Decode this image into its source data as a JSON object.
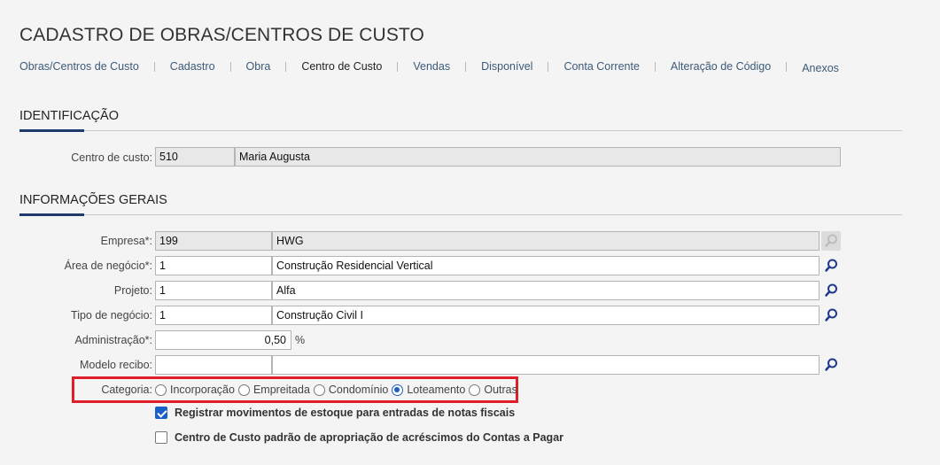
{
  "page": {
    "title": "CADASTRO DE OBRAS/CENTROS DE CUSTO"
  },
  "tabs": [
    {
      "label": "Obras/Centros de Custo"
    },
    {
      "label": "Cadastro"
    },
    {
      "label": "Obra"
    },
    {
      "label": "Centro de Custo"
    },
    {
      "label": "Vendas"
    },
    {
      "label": "Disponível"
    },
    {
      "label": "Conta Corrente"
    },
    {
      "label": "Alteração de Código"
    },
    {
      "label": "Anexos"
    }
  ],
  "identificacao": {
    "title": "IDENTIFICAÇÃO",
    "centro_label": "Centro de custo:",
    "centro_code": "510",
    "centro_name": "Maria Augusta"
  },
  "info": {
    "title": "INFORMAÇÕES GERAIS",
    "empresa": {
      "label": "Empresa*:",
      "code": "199",
      "name": "HWG"
    },
    "area": {
      "label": "Área de negócio*:",
      "code": "1",
      "name": "Construção Residencial Vertical"
    },
    "projeto": {
      "label": "Projeto:",
      "code": "1",
      "name": "Alfa"
    },
    "tipo": {
      "label": "Tipo de negócio:",
      "code": "1",
      "name": "Construção Civil I"
    },
    "administracao": {
      "label": "Administração*:",
      "value": "0,50",
      "unit": "%"
    },
    "modelo": {
      "label": "Modelo recibo:",
      "code": "",
      "name": ""
    }
  },
  "categoria": {
    "label": "Categoria:",
    "options": [
      "Incorporação",
      "Empreitada",
      "Condomínio",
      "Loteamento",
      "Outras"
    ],
    "selected": "Loteamento"
  },
  "checks": {
    "estoque": {
      "label": "Registrar movimentos de estoque para entradas de notas fiscais",
      "checked": true
    },
    "acrescimos": {
      "label": "Centro de Custo padrão de apropriação de acréscimos do Contas a Pagar",
      "checked": false
    }
  },
  "colors": {
    "accent": "#1e3a6e",
    "link": "#3c5a78",
    "highlight": "#e01e28",
    "control": "#1b60c7"
  }
}
